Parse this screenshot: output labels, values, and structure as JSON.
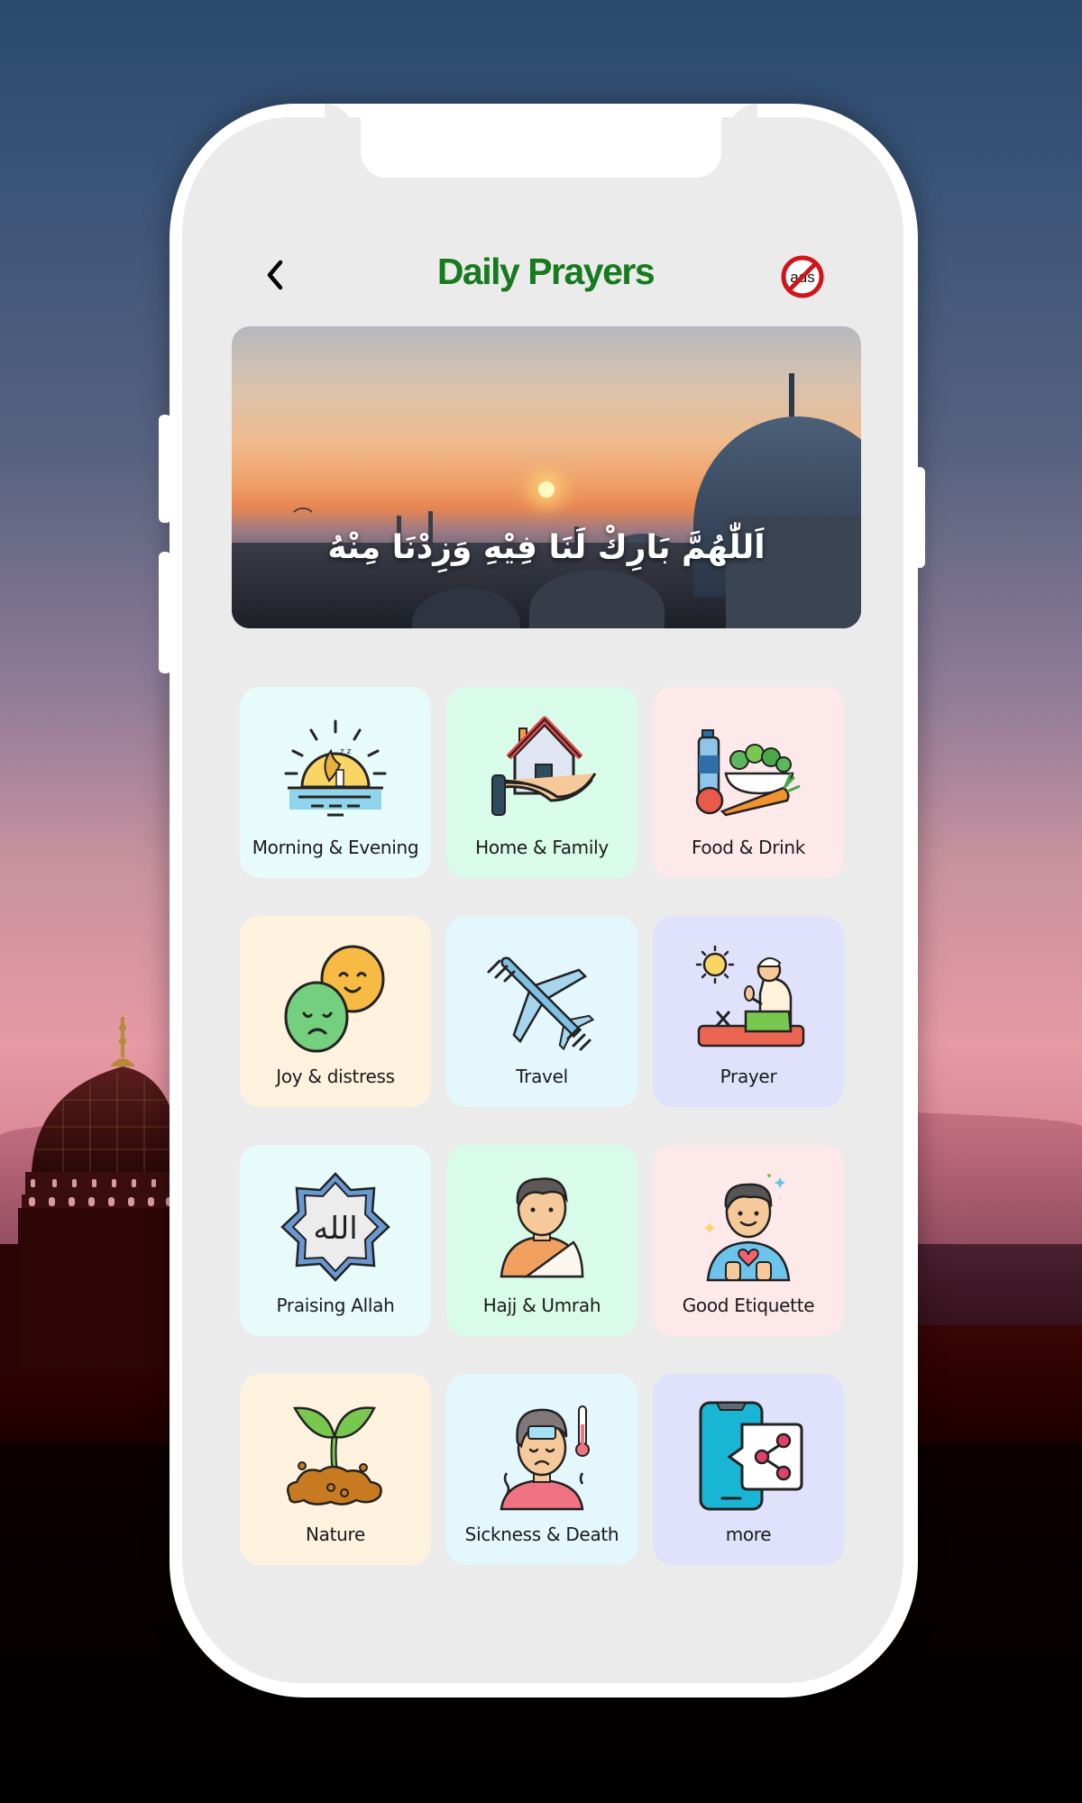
{
  "header": {
    "title": "Daily Prayers",
    "back_icon": "chevron-left-icon",
    "noads_label": "ads",
    "noads_icon": "no-ads-icon"
  },
  "banner": {
    "arabic_text": "اَللّٰهُمَّ بَارِكْ لَنَا فِيْهِ وَزِدْنَا مِنْهُ"
  },
  "colors": {
    "title_green": "#177a1e",
    "screen_bg": "#ebebeb",
    "noads_red": "#d0141a"
  },
  "categories": [
    {
      "label": "Morning & Evening",
      "icon": "sunrise-icon",
      "bg": "#e8fbfb"
    },
    {
      "label": "Home & Family",
      "icon": "house-in-hand-icon",
      "bg": "#d8fbea"
    },
    {
      "label": "Food & Drink",
      "icon": "food-drink-icon",
      "bg": "#fde8ea"
    },
    {
      "label": "Joy & distress",
      "icon": "emotions-icon",
      "bg": "#fdf2de"
    },
    {
      "label": "Travel",
      "icon": "airplane-icon",
      "bg": "#e3f7fc"
    },
    {
      "label": "Prayer",
      "icon": "praying-man-icon",
      "bg": "#e0e2fb"
    },
    {
      "label": "Praising Allah",
      "icon": "allah-star-icon",
      "bg": "#e8fbfb"
    },
    {
      "label": "Hajj & Umrah",
      "icon": "pilgrim-icon",
      "bg": "#d8fbea"
    },
    {
      "label": "Good Etiquette",
      "icon": "kind-person-icon",
      "bg": "#fde8ea"
    },
    {
      "label": "Nature",
      "icon": "sprout-icon",
      "bg": "#fdf2de"
    },
    {
      "label": "Sickness & Death",
      "icon": "sick-person-icon",
      "bg": "#e3f7fc"
    },
    {
      "label": "more",
      "icon": "share-app-icon",
      "bg": "#e0e2fb"
    }
  ]
}
